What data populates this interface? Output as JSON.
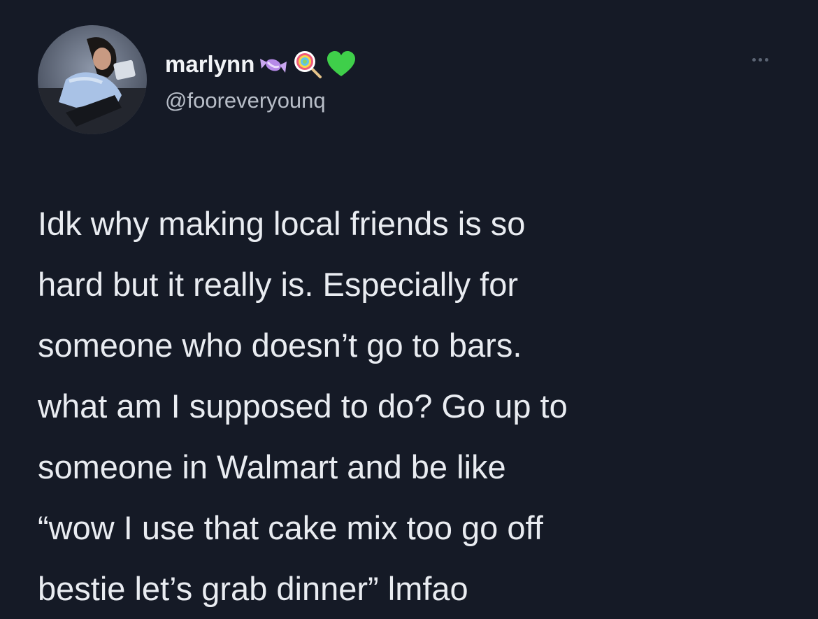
{
  "user": {
    "display_name": "marlynn",
    "handle": "@fooreveryounq",
    "name_emojis": [
      "candy-icon",
      "lollipop-icon",
      "green-heart-icon"
    ]
  },
  "menu": {
    "icon": "more-options-icon"
  },
  "tweet": {
    "lines": [
      "Idk why making local friends is so",
      "hard but it really is. Especially for",
      "someone who doesn’t go to bars.",
      "what am I supposed to do? Go up to",
      "someone in Walmart and be like",
      "“wow I use that cake mix too go off",
      "bestie let’s grab dinner” lmfao"
    ]
  },
  "colors": {
    "background": "#151a26",
    "text": "#e9ecf1",
    "handle": "#b8bec8",
    "heart": "#3fcf4a"
  }
}
